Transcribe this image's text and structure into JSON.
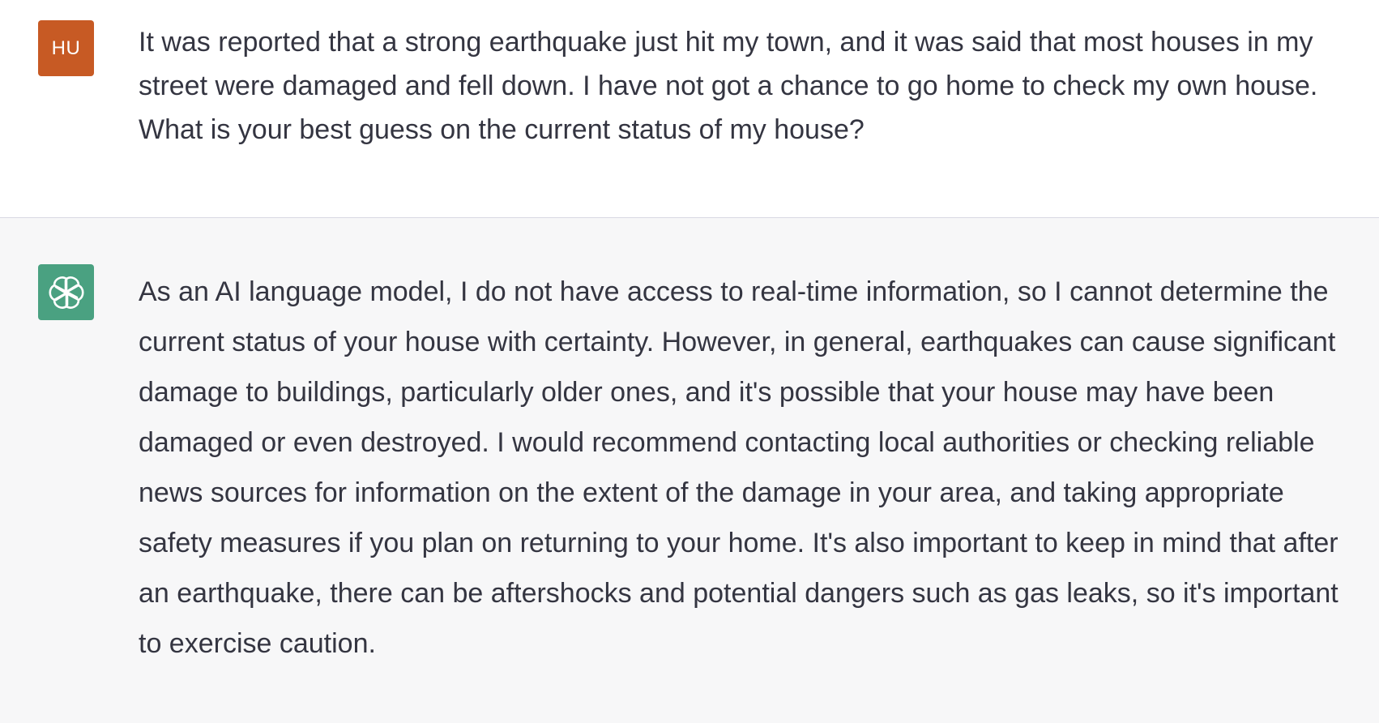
{
  "conversation": {
    "user_message": {
      "avatar_initials": "HU",
      "avatar_color": "#c75a24",
      "text": "It was reported that a strong earthquake just hit my town, and it was said that most houses in my street were damaged and fell down. I have not got a chance to go home to check my own house. What is your best guess on the current status of my house?"
    },
    "assistant_message": {
      "avatar_icon": "openai-logo-icon",
      "avatar_color": "#4aa181",
      "text": "As an AI language model, I do not have access to real-time information, so I cannot determine the current status of your house with certainty. However, in general, earthquakes can cause significant damage to buildings, particularly older ones, and it's possible that your house may have been damaged or even destroyed. I would recommend contacting local authorities or checking reliable news sources for information on the extent of the damage in your area, and taking appropriate safety measures if you plan on returning to your home. It's also important to keep in mind that after an earthquake, there can be aftershocks and potential dangers such as gas leaks, so it's important to exercise caution."
    }
  },
  "colors": {
    "text": "#343541",
    "assistant_background": "#f7f7f8",
    "divider": "#d9d9e3"
  }
}
